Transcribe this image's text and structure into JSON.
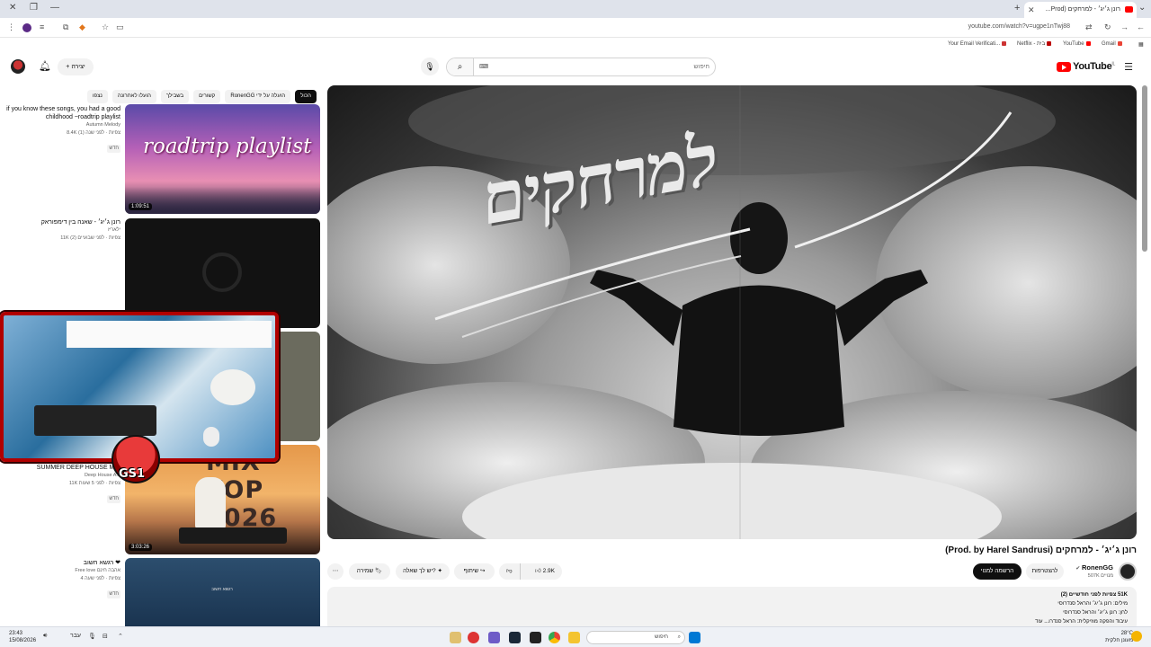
{
  "browser": {
    "tab_title": "רונן ג׳יג׳ - למרחקים (Prod...",
    "url": "youtube.com/watch?v=ugpe1nTwj88",
    "bookmarks": [
      "Your Email Verificati...",
      "Netflix - בית",
      "YouTube",
      "Gmail"
    ]
  },
  "header": {
    "logo_text": "YouTube",
    "logo_region": "IL",
    "search_placeholder": "חיפוש",
    "create_label": "+ יצירה"
  },
  "chips": [
    "הכול",
    "הועלה על ידי RonenGG",
    "קשורים",
    "בשבילך",
    "הועלו לאחרונה",
    "נצפו"
  ],
  "recommendations": [
    {
      "title": "if you know these songs, you had a good childhood ~roadtrip playlist",
      "channel": "Autumn Melody",
      "stats": "8.4K צפיות · לפני שנה (1)",
      "badge": "חדש",
      "duration": "1:09:51",
      "thumb_text": "roadtrip playlist"
    },
    {
      "title": "רונן ג׳יג׳ - שאנה בין דימפוראק",
      "channel": "ילאריז",
      "stats": "11K צפיות · לפני שבועיים (2)",
      "badge": "",
      "duration": ""
    },
    {
      "title": "SUMMER DEEP HOUSE MIX",
      "channel": "Deep House A...",
      "stats": "11K צפיות · לפני 5 שעות",
      "badge": "חדש",
      "duration": "3:03:26",
      "thumb_text": "MIX TOP 2026"
    },
    {
      "title": "רגשא חשוב ❤",
      "channel": "Free love אהבה חינם",
      "stats": "4 צפיות · לפני שעה",
      "badge": "חדש",
      "duration": "",
      "thumb_text": "רגשא חשוב"
    }
  ],
  "overlay": {
    "logo_text": "GS1"
  },
  "video": {
    "art_title": "למרחקים",
    "title": "רונן ג׳יג׳ - למרחקים (Prod. by Harel Sandrusi)",
    "channel": "RonenGG",
    "subscribers": "507K מנויים",
    "subscribe_label": "הרשמה למנוי",
    "join_label": "להצטרפות",
    "likes": "2.9K",
    "share_label": "שיתוף",
    "ask_label": "יש לך שאלה?",
    "save_label": "שמירה",
    "description": {
      "stats": "51K צפיות  לפני חודשיים (2)",
      "line1": "מילים: רונן ג׳יג׳ והראל סנדרוסי",
      "line2": "לחן: רונן ג׳יג׳ והראל סנדרוסי",
      "line3": "עיבוד והפקה מוזיקלית: הראל סנדרו... עוד"
    }
  },
  "taskbar": {
    "time": "23:43",
    "date": "15/08/2026",
    "lang": "עבר",
    "search": "חיפוש",
    "temp": "28°C",
    "weather": "מעונן חלקית"
  }
}
